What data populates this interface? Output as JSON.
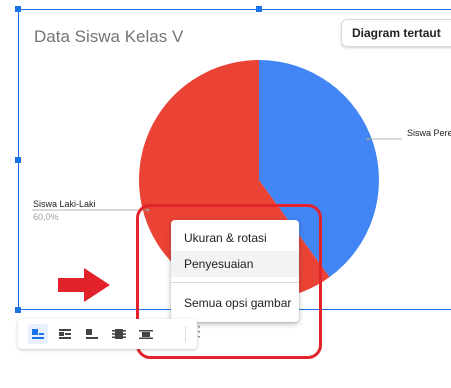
{
  "chart": {
    "title": "Data Siswa Kelas V",
    "linked_label": "Diagram tertaut",
    "more_icon": "⋮"
  },
  "chart_data": {
    "type": "pie",
    "title": "Data Siswa Kelas V",
    "slices": [
      {
        "name": "Siswa Perempuan",
        "value": 40.0,
        "color": "#4285f4",
        "label": "Siswa Pere"
      },
      {
        "name": "Siswa Laki-Laki",
        "value": 60.0,
        "color": "#ea4335",
        "label": "Siswa Laki-Laki",
        "percent_label": "60,0%"
      }
    ]
  },
  "context_menu": {
    "items": [
      {
        "label": "Ukuran & rotasi"
      },
      {
        "label": "Penyesuaian"
      },
      {
        "label": "Semua opsi gambar"
      }
    ]
  },
  "toolbar": {
    "buttons": [
      {
        "icon": "inline-wrap-icon",
        "active": true
      },
      {
        "icon": "wrap-text-icon",
        "active": false
      },
      {
        "icon": "break-text-icon",
        "active": false
      },
      {
        "icon": "behind-text-icon",
        "active": false
      },
      {
        "icon": "in-front-of-text-icon",
        "active": false
      }
    ],
    "more_icon": "⋮"
  },
  "annotation": {
    "arrow_color": "#e3232b",
    "frame_color": "#e3232b"
  }
}
